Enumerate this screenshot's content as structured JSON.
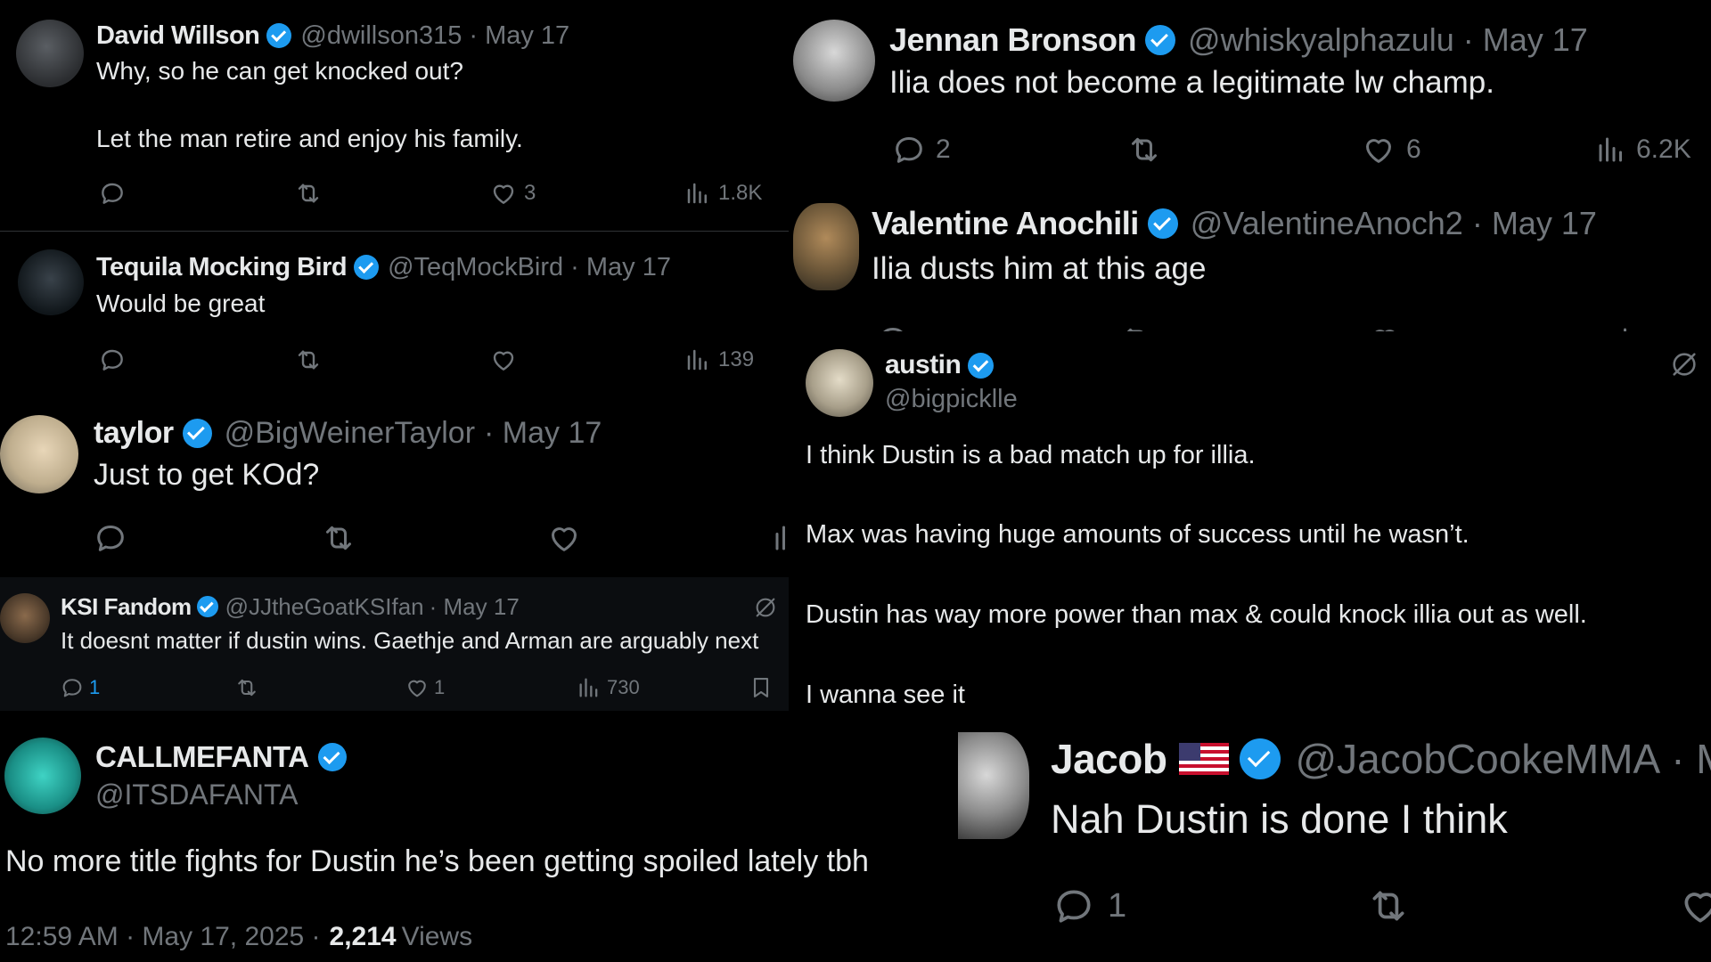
{
  "colors": {
    "background": "#000000",
    "text": "#e7e9ea",
    "muted": "#71767b",
    "verified": "#1d9bf0",
    "reply_active": "#1d9bf0"
  },
  "tweets": {
    "david": {
      "name": "David Willson",
      "handle": "@dwillson315",
      "date": "· May 17",
      "line1": "Why, so he can get knocked out?",
      "line2": "Let the man retire and enjoy his family.",
      "likes": "3",
      "views": "1.8K"
    },
    "jennan": {
      "name": "Jennan Bronson",
      "handle": "@whiskyalphazulu",
      "date": "· May 17",
      "text": "Ilia does not become a legitimate lw champ.",
      "replies": "2",
      "likes": "6",
      "views": "6.2K"
    },
    "tequila": {
      "name": "Tequila Mocking Bird",
      "handle": "@TeqMockBird",
      "date": "· May 17",
      "text": "Would be great",
      "views": "139"
    },
    "valentine": {
      "name": "Valentine Anochili",
      "handle": "@ValentineAnoch2",
      "date": "· May 17",
      "text": "Ilia dusts him at this age"
    },
    "taylor": {
      "name": "taylor",
      "handle": "@BigWeinerTaylor",
      "date": "· May 17",
      "text": "Just to get KOd?"
    },
    "austin": {
      "name": "austin",
      "handle": "@bigpicklle",
      "line1": "I think Dustin is a bad match up for illia.",
      "line2": "Max was having huge amounts of success until he wasn’t.",
      "line3": "Dustin has way more power than max & could knock illia out as well.",
      "line4": "I wanna see it"
    },
    "ksi": {
      "name": "KSI Fandom",
      "handle": "@JJtheGoatKSIfan",
      "date": "· May 17",
      "text": "It doesnt matter if dustin wins. Gaethje and Arman are arguably next",
      "replies": "1",
      "likes": "1",
      "views": "730"
    },
    "fanta": {
      "name": "CALLMEFANTA",
      "handle": "@ITSDAFANTA",
      "text": "No more title fights for Dustin he’s been getting spoiled lately tbh",
      "time": "12:59 AM · May 17, 2025 ·",
      "views_count": "2,214",
      "views_label": "Views"
    },
    "jacob": {
      "name": "Jacob",
      "handle": "@JacobCookeMMA",
      "date": "· M",
      "text": "Nah Dustin is done I think",
      "replies": "1"
    }
  },
  "icons": [
    "reply-icon",
    "retweet-icon",
    "like-icon",
    "views-icon",
    "bookmark-icon",
    "grok-icon",
    "verified-badge-icon",
    "us-flag-icon"
  ]
}
